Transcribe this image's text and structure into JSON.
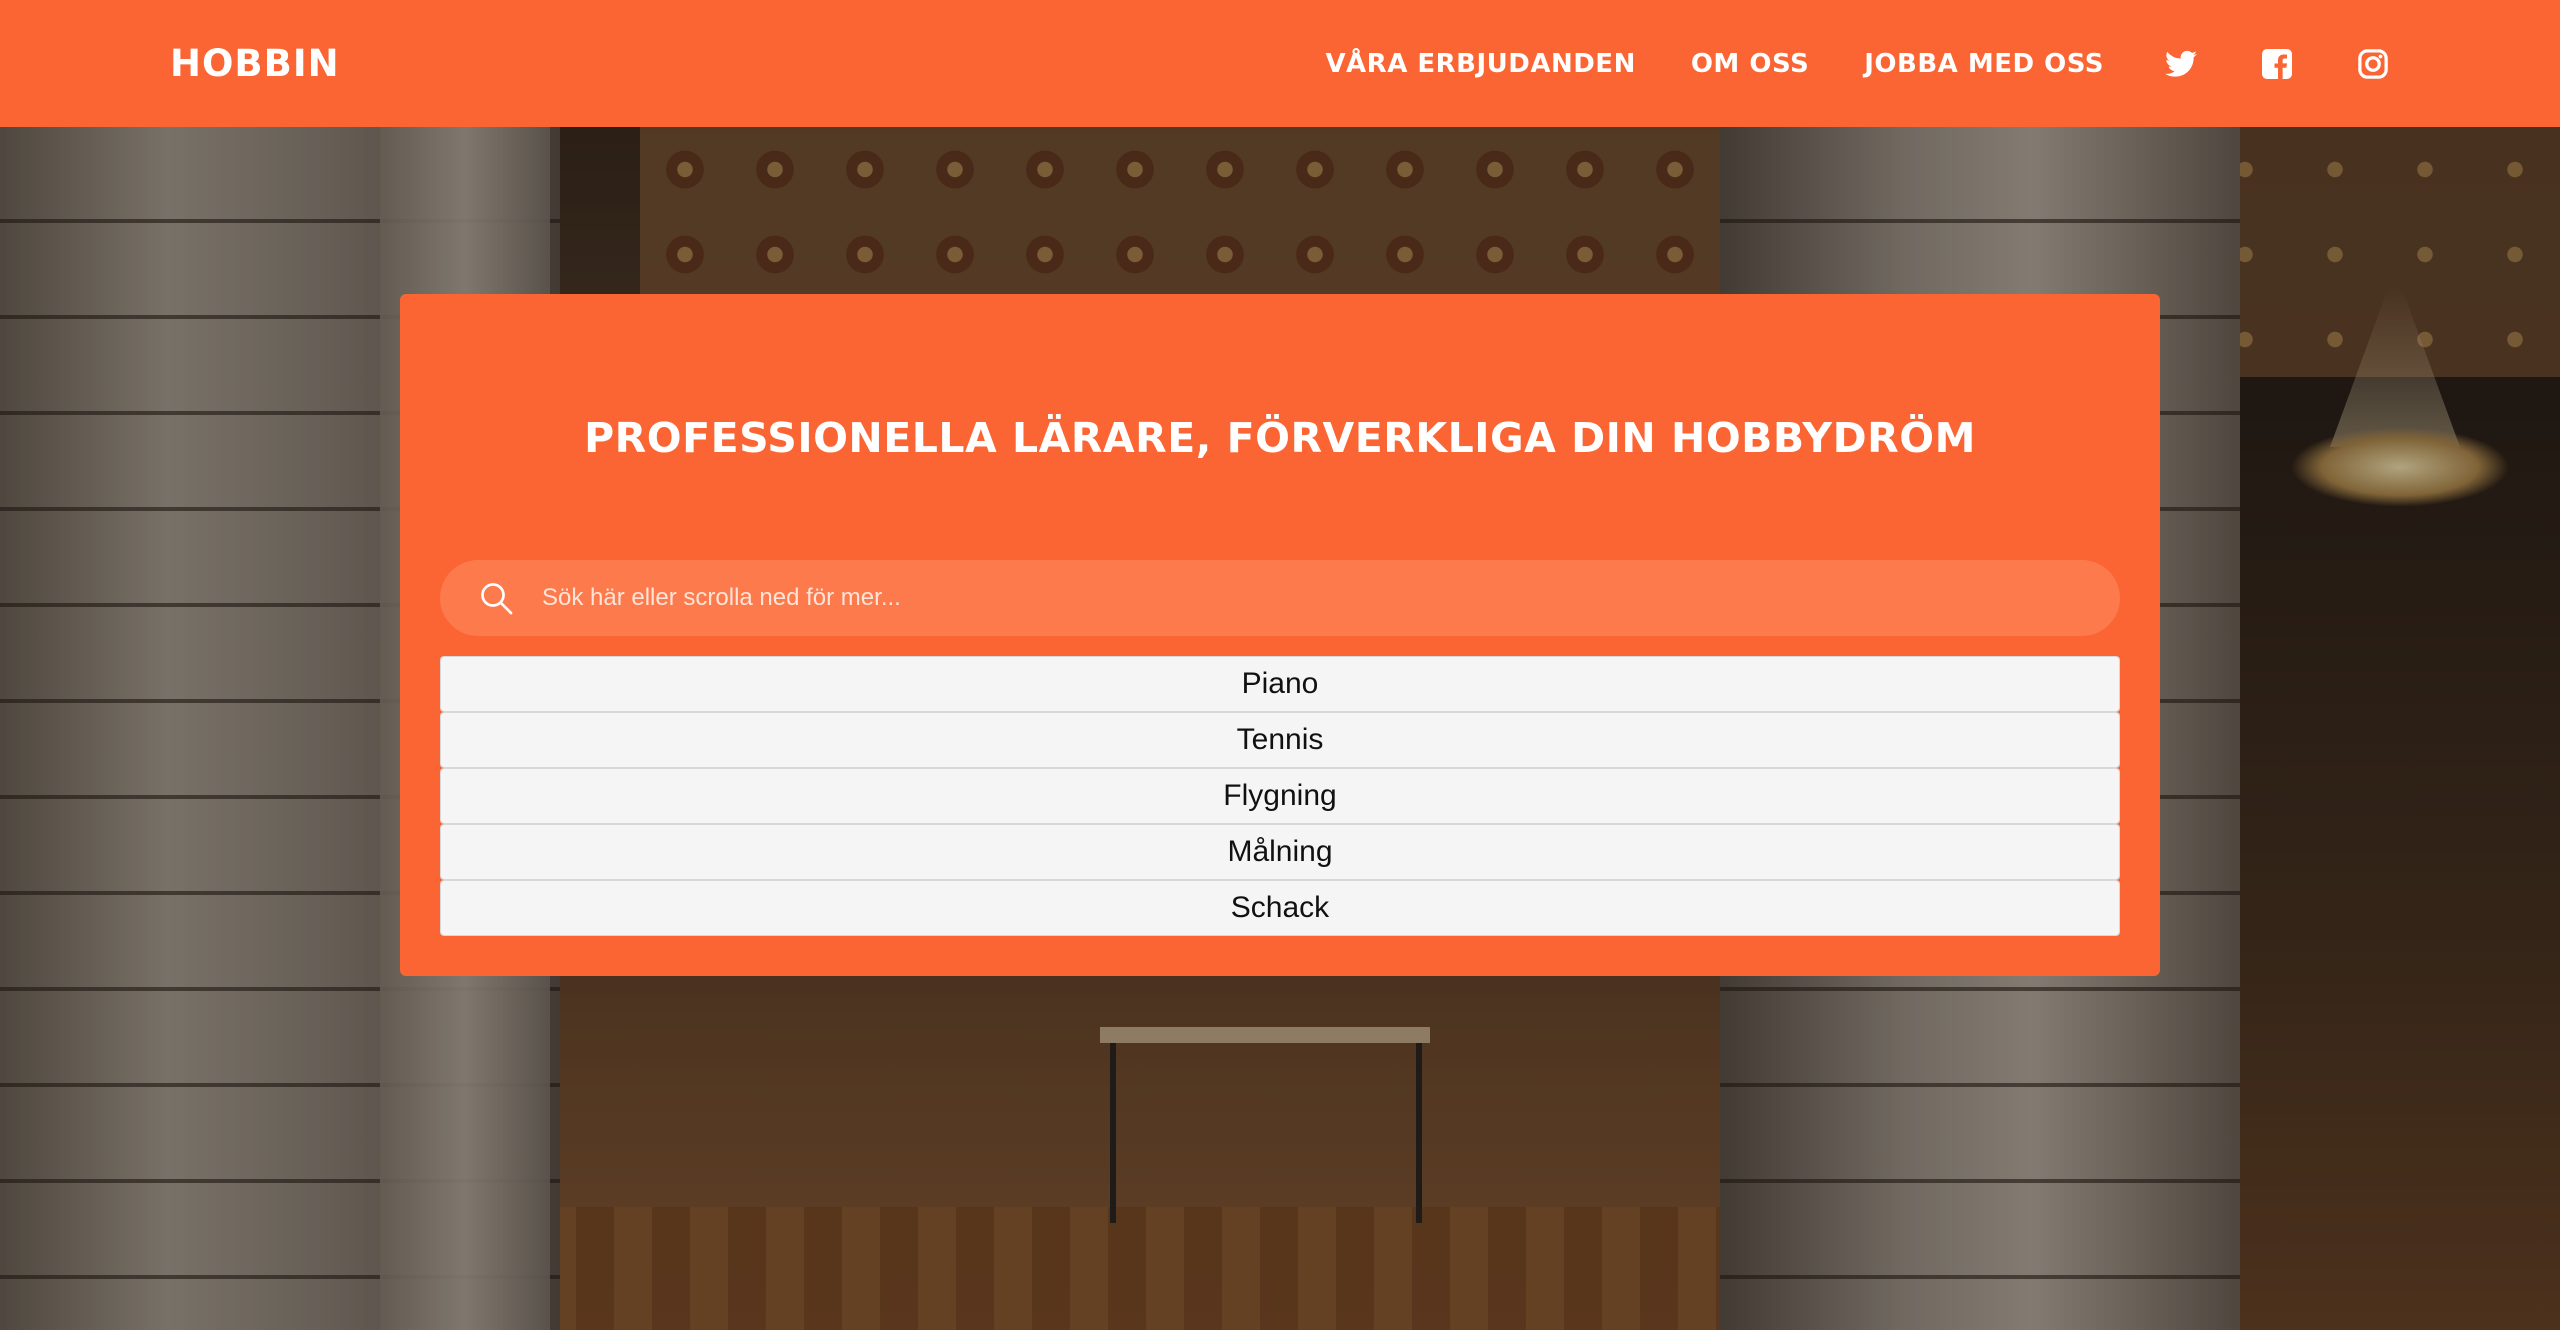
{
  "header": {
    "logo": "HOBBIN",
    "nav": [
      {
        "label": "VÅRA ERBJUDANDEN"
      },
      {
        "label": "OM OSS"
      },
      {
        "label": "JOBBA MED OSS"
      }
    ],
    "social_icons": [
      "twitter-icon",
      "facebook-icon",
      "instagram-icon"
    ]
  },
  "hero": {
    "headline": "PROFESSIONELLA LÄRARE, FÖRVERKLIGA DIN HOBBYDRÖM",
    "search": {
      "placeholder": "Sök här eller scrolla ned för mer...",
      "value": ""
    },
    "options": [
      "Piano",
      "Tennis",
      "Flygning",
      "Målning",
      "Schack"
    ]
  },
  "colors": {
    "brand_orange": "#fb6433",
    "search_bg": "#fd7a4d",
    "list_bg": "#f5f5f5"
  }
}
